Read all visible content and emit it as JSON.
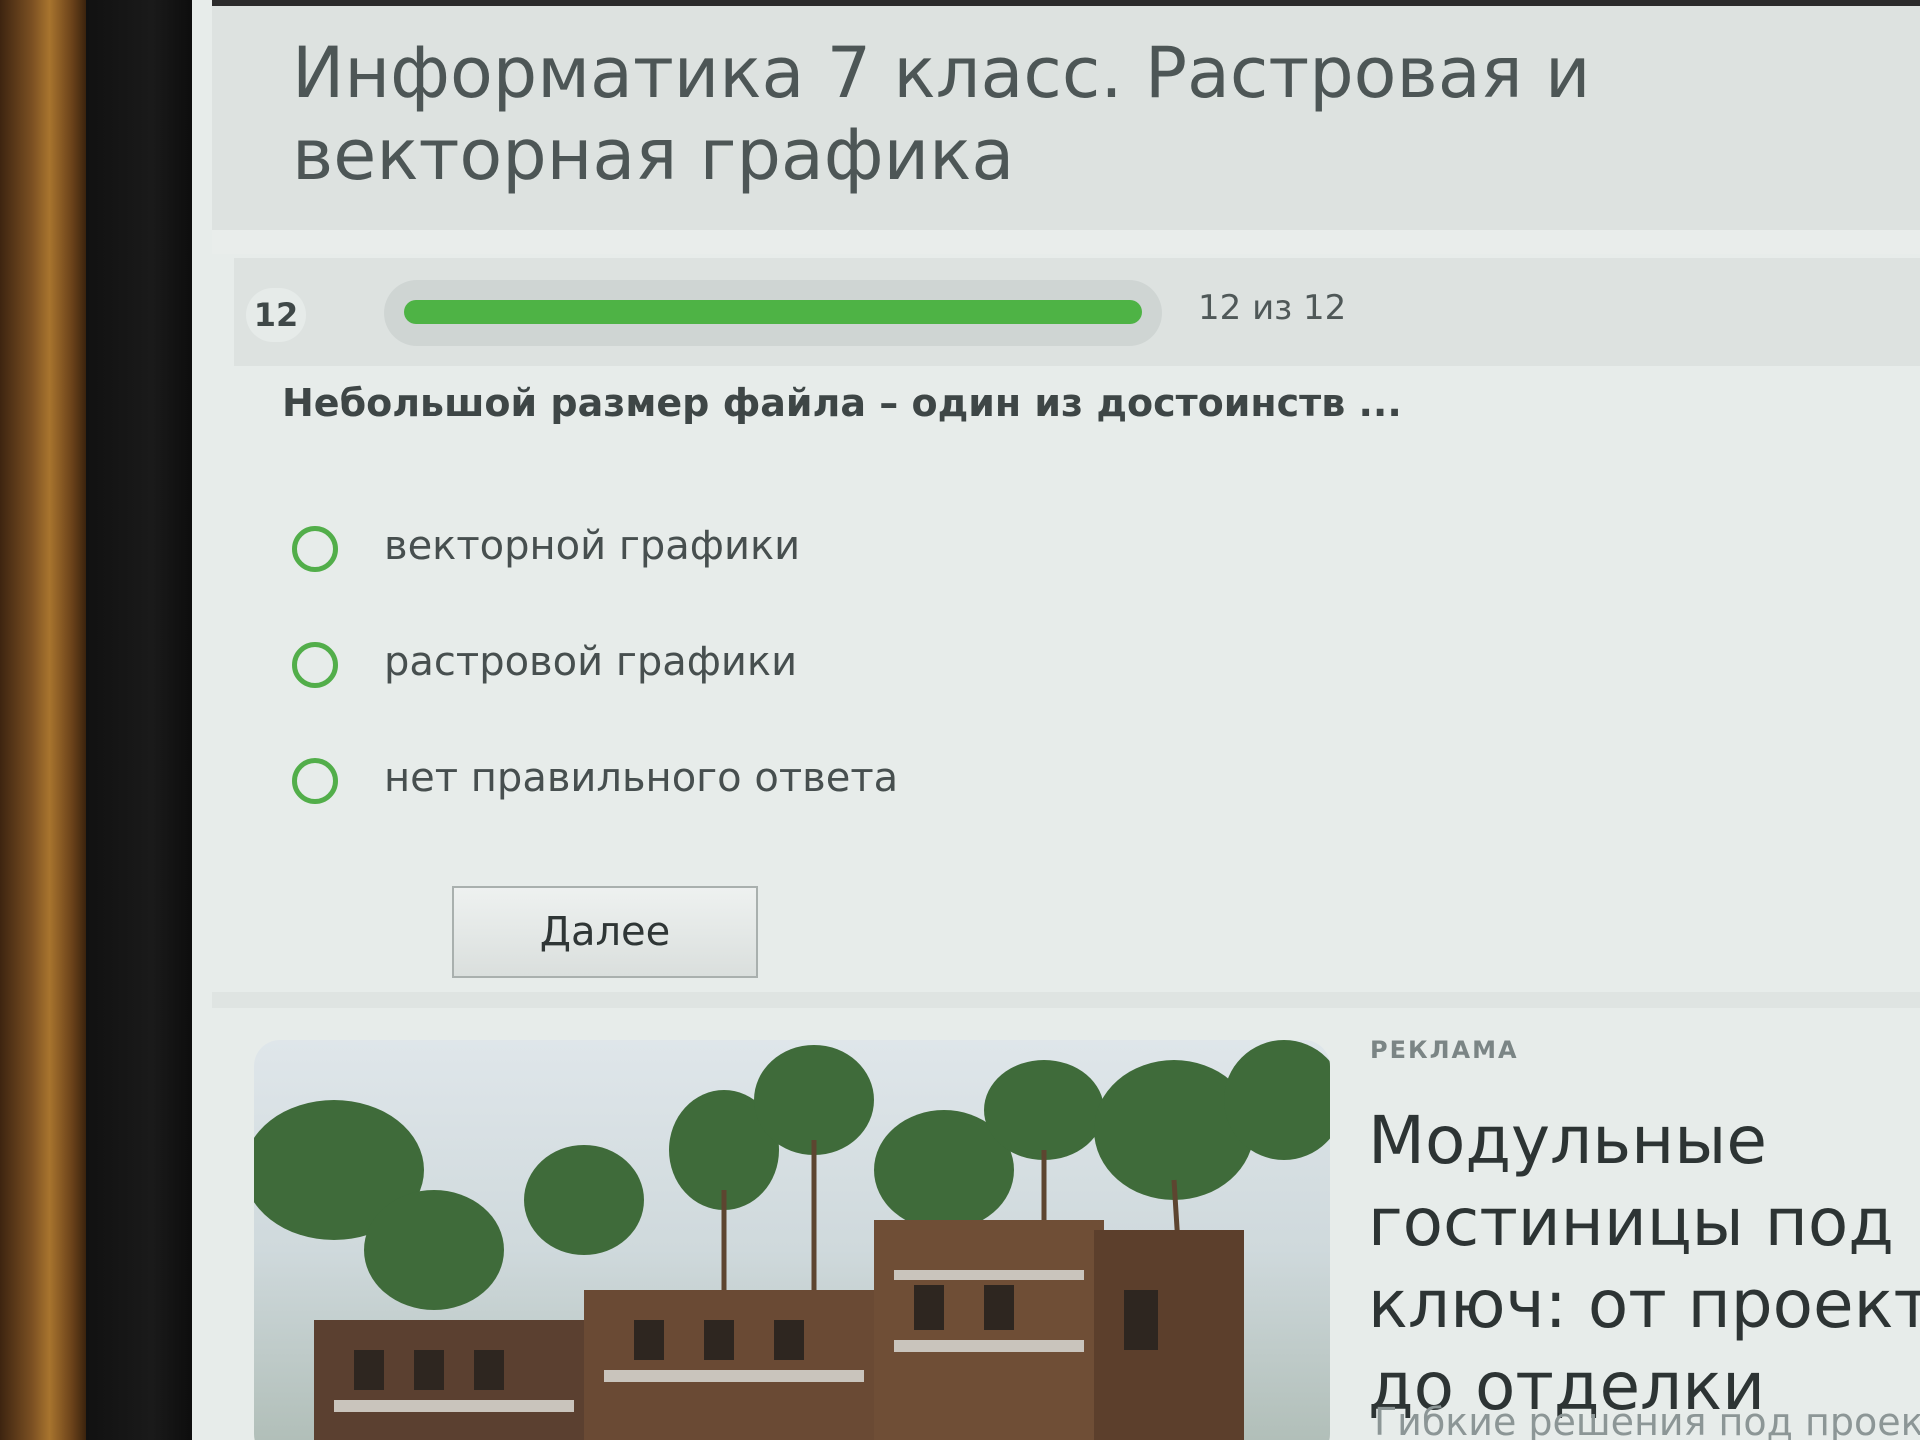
{
  "page": {
    "title": "Информатика 7 класс. Растровая и векторная графика"
  },
  "progress": {
    "current_number": "12",
    "counter_text": "12 из 12",
    "fraction": 1.0
  },
  "question": {
    "text": "Небольшой размер файла – один из достоинств ..."
  },
  "options": [
    {
      "label": "векторной графики"
    },
    {
      "label": "растровой графики"
    },
    {
      "label": "нет правильного ответа"
    }
  ],
  "actions": {
    "next_label": "Далее"
  },
  "ad": {
    "label": "РЕКЛАМА",
    "title": "Модульные гостиницы под ключ: от проекта до отделки",
    "subtitle": "Гибкие решения под проект"
  },
  "colors": {
    "accent_green": "#4eb345",
    "radio_border": "#52ae4a"
  }
}
